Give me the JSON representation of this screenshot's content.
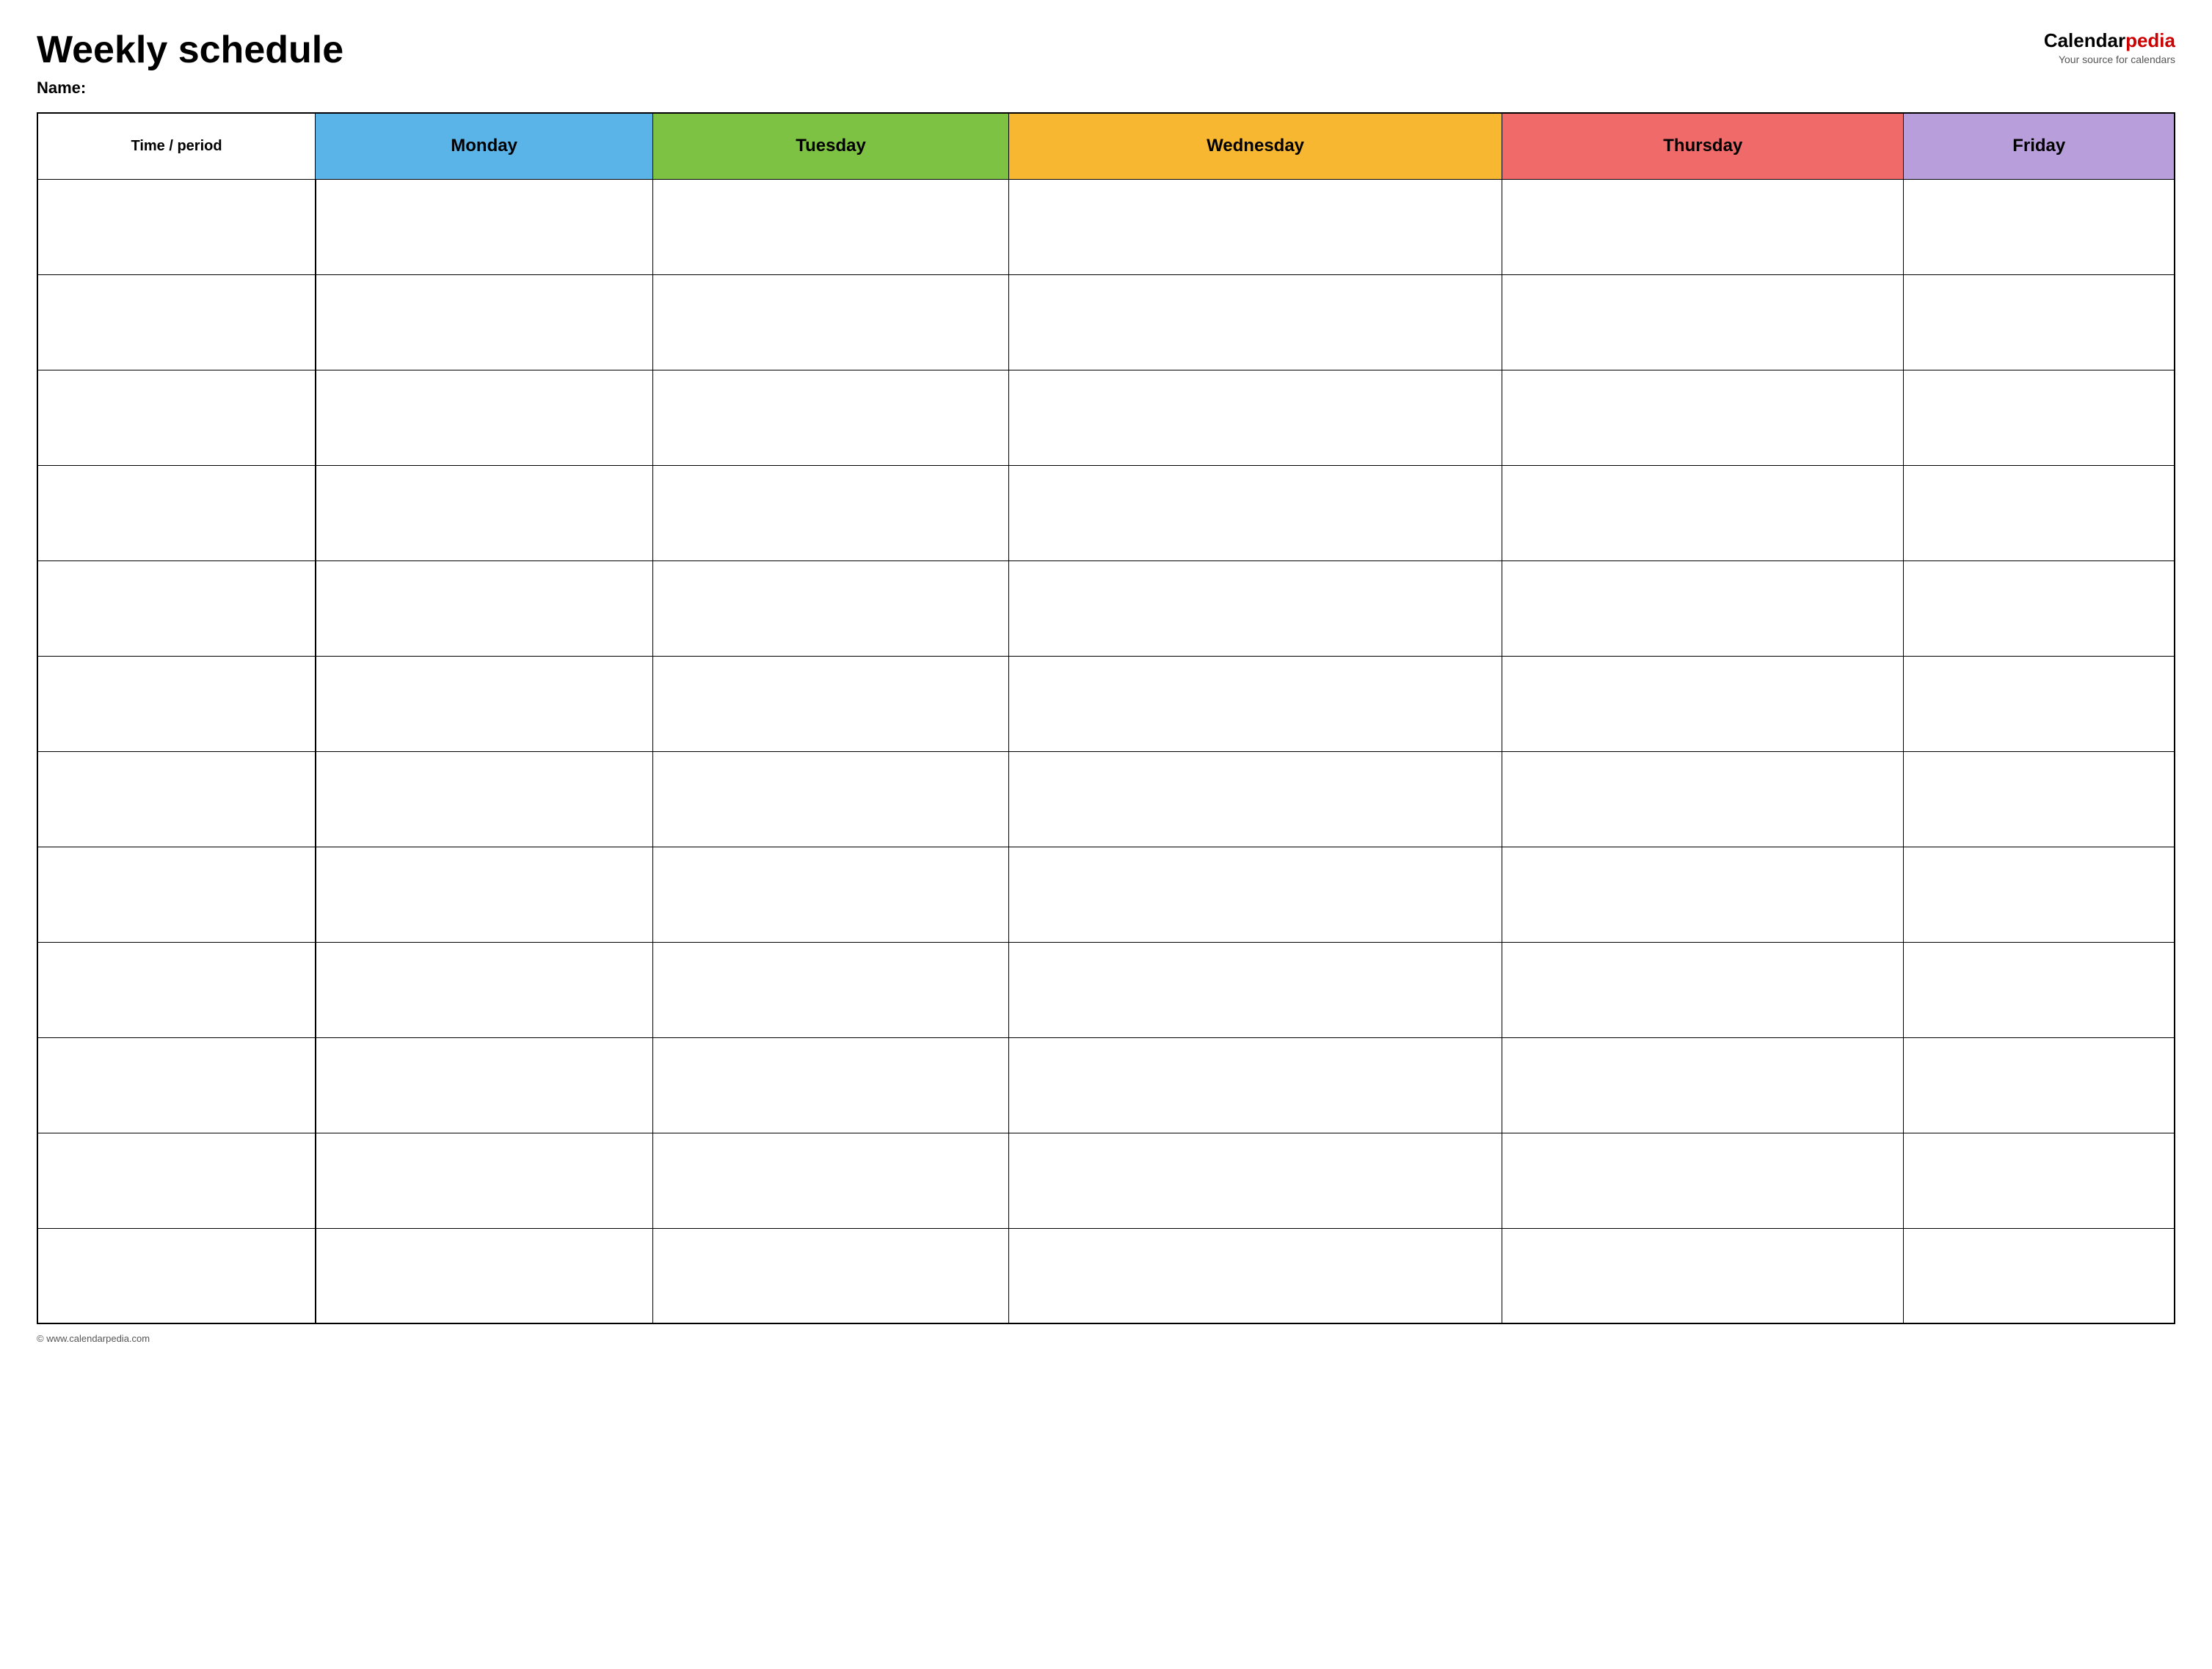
{
  "header": {
    "title": "Weekly schedule",
    "name_label": "Name:",
    "logo": {
      "brand_black": "Calendar",
      "brand_red": "pedia",
      "tagline": "Your source for calendars"
    }
  },
  "table": {
    "columns": [
      {
        "key": "time",
        "label": "Time / period",
        "color": "#ffffff"
      },
      {
        "key": "monday",
        "label": "Monday",
        "color": "#5ab4e8"
      },
      {
        "key": "tuesday",
        "label": "Tuesday",
        "color": "#7dc242"
      },
      {
        "key": "wednesday",
        "label": "Wednesday",
        "color": "#f7b731"
      },
      {
        "key": "thursday",
        "label": "Thursday",
        "color": "#f06a6a"
      },
      {
        "key": "friday",
        "label": "Friday",
        "color": "#b89fdc"
      }
    ],
    "row_count": 12
  },
  "footer": {
    "copyright": "© www.calendarpedia.com"
  }
}
